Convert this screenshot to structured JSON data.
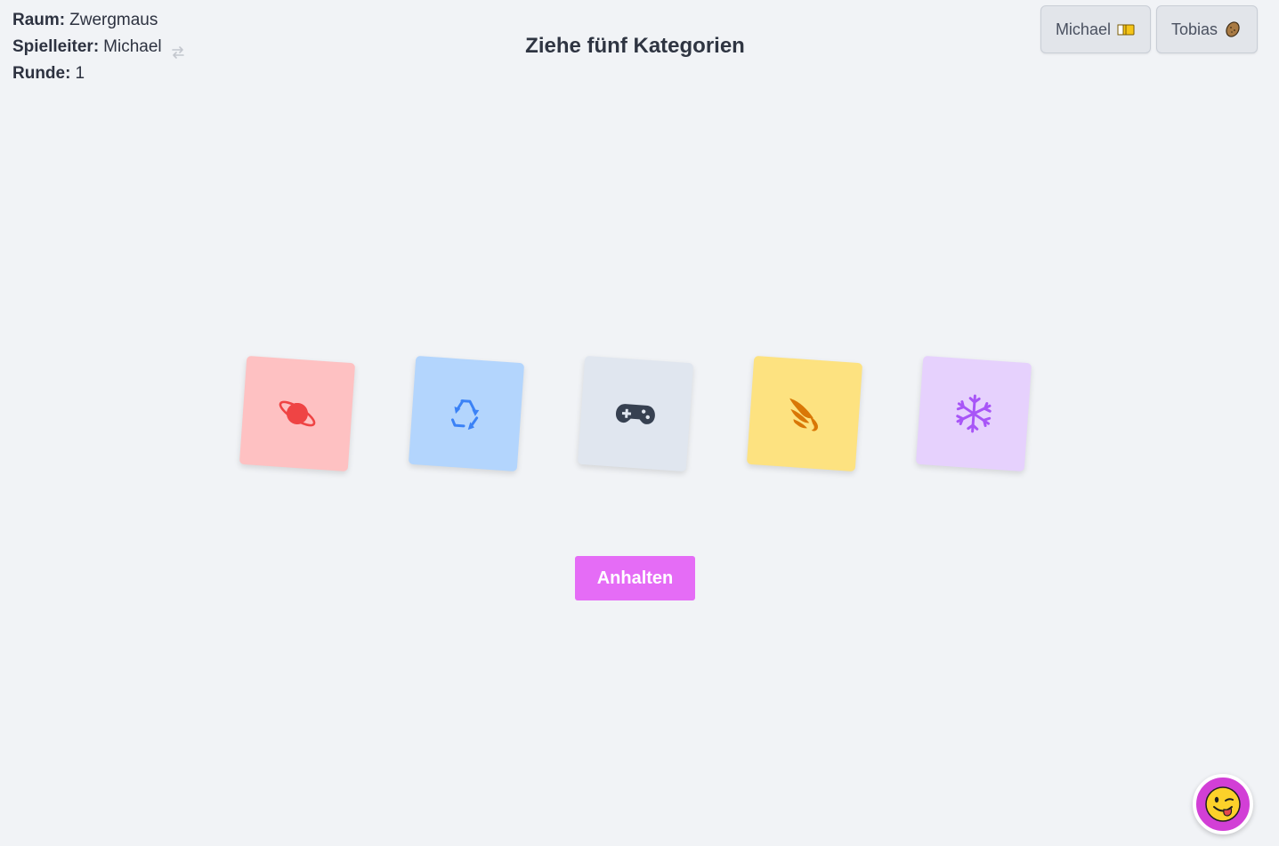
{
  "room": {
    "label": "Raum:",
    "value": "Zwergmaus"
  },
  "game_master": {
    "label": "Spielleiter:",
    "value": "Michael",
    "swap_icon": "swap-arrows-icon"
  },
  "round": {
    "label": "Runde:",
    "value": "1"
  },
  "title": "Ziehe fünf Kategorien",
  "players": [
    {
      "name": "Michael",
      "badge_icon": "flag-badge-icon"
    },
    {
      "name": "Tobias",
      "badge_icon": "potato-badge-icon"
    }
  ],
  "categories": [
    {
      "icon": "planet-icon",
      "card_color": "#fec1c2",
      "icon_color": "#ef4444"
    },
    {
      "icon": "recycle-icon",
      "card_color": "#b3d5fd",
      "icon_color": "#3b82f6"
    },
    {
      "icon": "gamepad-icon",
      "card_color": "#e0e6ef",
      "icon_color": "#374151"
    },
    {
      "icon": "wing-icon",
      "card_color": "#fde280",
      "icon_color": "#d97706"
    },
    {
      "icon": "snowflake-icon",
      "card_color": "#e6d1fd",
      "icon_color": "#a855f7"
    }
  ],
  "actions": {
    "stop_label": "Anhalten",
    "stop_color": "#e56cf6"
  },
  "emoji_button": {
    "icon": "winking-tongue-face-icon",
    "color": "#d23fd6"
  }
}
